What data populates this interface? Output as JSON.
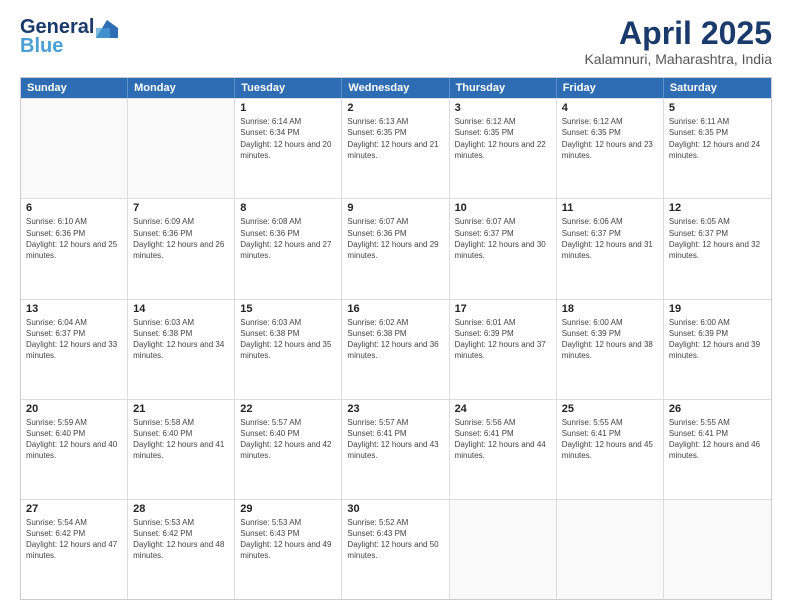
{
  "header": {
    "logo_line1": "General",
    "logo_line2": "Blue",
    "title": "April 2025",
    "subtitle": "Kalamnuri, Maharashtra, India"
  },
  "days_of_week": [
    "Sunday",
    "Monday",
    "Tuesday",
    "Wednesday",
    "Thursday",
    "Friday",
    "Saturday"
  ],
  "weeks": [
    [
      {
        "day": "",
        "sunrise": "",
        "sunset": "",
        "daylight": ""
      },
      {
        "day": "",
        "sunrise": "",
        "sunset": "",
        "daylight": ""
      },
      {
        "day": "1",
        "sunrise": "Sunrise: 6:14 AM",
        "sunset": "Sunset: 6:34 PM",
        "daylight": "Daylight: 12 hours and 20 minutes."
      },
      {
        "day": "2",
        "sunrise": "Sunrise: 6:13 AM",
        "sunset": "Sunset: 6:35 PM",
        "daylight": "Daylight: 12 hours and 21 minutes."
      },
      {
        "day": "3",
        "sunrise": "Sunrise: 6:12 AM",
        "sunset": "Sunset: 6:35 PM",
        "daylight": "Daylight: 12 hours and 22 minutes."
      },
      {
        "day": "4",
        "sunrise": "Sunrise: 6:12 AM",
        "sunset": "Sunset: 6:35 PM",
        "daylight": "Daylight: 12 hours and 23 minutes."
      },
      {
        "day": "5",
        "sunrise": "Sunrise: 6:11 AM",
        "sunset": "Sunset: 6:35 PM",
        "daylight": "Daylight: 12 hours and 24 minutes."
      }
    ],
    [
      {
        "day": "6",
        "sunrise": "Sunrise: 6:10 AM",
        "sunset": "Sunset: 6:36 PM",
        "daylight": "Daylight: 12 hours and 25 minutes."
      },
      {
        "day": "7",
        "sunrise": "Sunrise: 6:09 AM",
        "sunset": "Sunset: 6:36 PM",
        "daylight": "Daylight: 12 hours and 26 minutes."
      },
      {
        "day": "8",
        "sunrise": "Sunrise: 6:08 AM",
        "sunset": "Sunset: 6:36 PM",
        "daylight": "Daylight: 12 hours and 27 minutes."
      },
      {
        "day": "9",
        "sunrise": "Sunrise: 6:07 AM",
        "sunset": "Sunset: 6:36 PM",
        "daylight": "Daylight: 12 hours and 29 minutes."
      },
      {
        "day": "10",
        "sunrise": "Sunrise: 6:07 AM",
        "sunset": "Sunset: 6:37 PM",
        "daylight": "Daylight: 12 hours and 30 minutes."
      },
      {
        "day": "11",
        "sunrise": "Sunrise: 6:06 AM",
        "sunset": "Sunset: 6:37 PM",
        "daylight": "Daylight: 12 hours and 31 minutes."
      },
      {
        "day": "12",
        "sunrise": "Sunrise: 6:05 AM",
        "sunset": "Sunset: 6:37 PM",
        "daylight": "Daylight: 12 hours and 32 minutes."
      }
    ],
    [
      {
        "day": "13",
        "sunrise": "Sunrise: 6:04 AM",
        "sunset": "Sunset: 6:37 PM",
        "daylight": "Daylight: 12 hours and 33 minutes."
      },
      {
        "day": "14",
        "sunrise": "Sunrise: 6:03 AM",
        "sunset": "Sunset: 6:38 PM",
        "daylight": "Daylight: 12 hours and 34 minutes."
      },
      {
        "day": "15",
        "sunrise": "Sunrise: 6:03 AM",
        "sunset": "Sunset: 6:38 PM",
        "daylight": "Daylight: 12 hours and 35 minutes."
      },
      {
        "day": "16",
        "sunrise": "Sunrise: 6:02 AM",
        "sunset": "Sunset: 6:38 PM",
        "daylight": "Daylight: 12 hours and 36 minutes."
      },
      {
        "day": "17",
        "sunrise": "Sunrise: 6:01 AM",
        "sunset": "Sunset: 6:39 PM",
        "daylight": "Daylight: 12 hours and 37 minutes."
      },
      {
        "day": "18",
        "sunrise": "Sunrise: 6:00 AM",
        "sunset": "Sunset: 6:39 PM",
        "daylight": "Daylight: 12 hours and 38 minutes."
      },
      {
        "day": "19",
        "sunrise": "Sunrise: 6:00 AM",
        "sunset": "Sunset: 6:39 PM",
        "daylight": "Daylight: 12 hours and 39 minutes."
      }
    ],
    [
      {
        "day": "20",
        "sunrise": "Sunrise: 5:59 AM",
        "sunset": "Sunset: 6:40 PM",
        "daylight": "Daylight: 12 hours and 40 minutes."
      },
      {
        "day": "21",
        "sunrise": "Sunrise: 5:58 AM",
        "sunset": "Sunset: 6:40 PM",
        "daylight": "Daylight: 12 hours and 41 minutes."
      },
      {
        "day": "22",
        "sunrise": "Sunrise: 5:57 AM",
        "sunset": "Sunset: 6:40 PM",
        "daylight": "Daylight: 12 hours and 42 minutes."
      },
      {
        "day": "23",
        "sunrise": "Sunrise: 5:57 AM",
        "sunset": "Sunset: 6:41 PM",
        "daylight": "Daylight: 12 hours and 43 minutes."
      },
      {
        "day": "24",
        "sunrise": "Sunrise: 5:56 AM",
        "sunset": "Sunset: 6:41 PM",
        "daylight": "Daylight: 12 hours and 44 minutes."
      },
      {
        "day": "25",
        "sunrise": "Sunrise: 5:55 AM",
        "sunset": "Sunset: 6:41 PM",
        "daylight": "Daylight: 12 hours and 45 minutes."
      },
      {
        "day": "26",
        "sunrise": "Sunrise: 5:55 AM",
        "sunset": "Sunset: 6:41 PM",
        "daylight": "Daylight: 12 hours and 46 minutes."
      }
    ],
    [
      {
        "day": "27",
        "sunrise": "Sunrise: 5:54 AM",
        "sunset": "Sunset: 6:42 PM",
        "daylight": "Daylight: 12 hours and 47 minutes."
      },
      {
        "day": "28",
        "sunrise": "Sunrise: 5:53 AM",
        "sunset": "Sunset: 6:42 PM",
        "daylight": "Daylight: 12 hours and 48 minutes."
      },
      {
        "day": "29",
        "sunrise": "Sunrise: 5:53 AM",
        "sunset": "Sunset: 6:43 PM",
        "daylight": "Daylight: 12 hours and 49 minutes."
      },
      {
        "day": "30",
        "sunrise": "Sunrise: 5:52 AM",
        "sunset": "Sunset: 6:43 PM",
        "daylight": "Daylight: 12 hours and 50 minutes."
      },
      {
        "day": "",
        "sunrise": "",
        "sunset": "",
        "daylight": ""
      },
      {
        "day": "",
        "sunrise": "",
        "sunset": "",
        "daylight": ""
      },
      {
        "day": "",
        "sunrise": "",
        "sunset": "",
        "daylight": ""
      }
    ]
  ]
}
